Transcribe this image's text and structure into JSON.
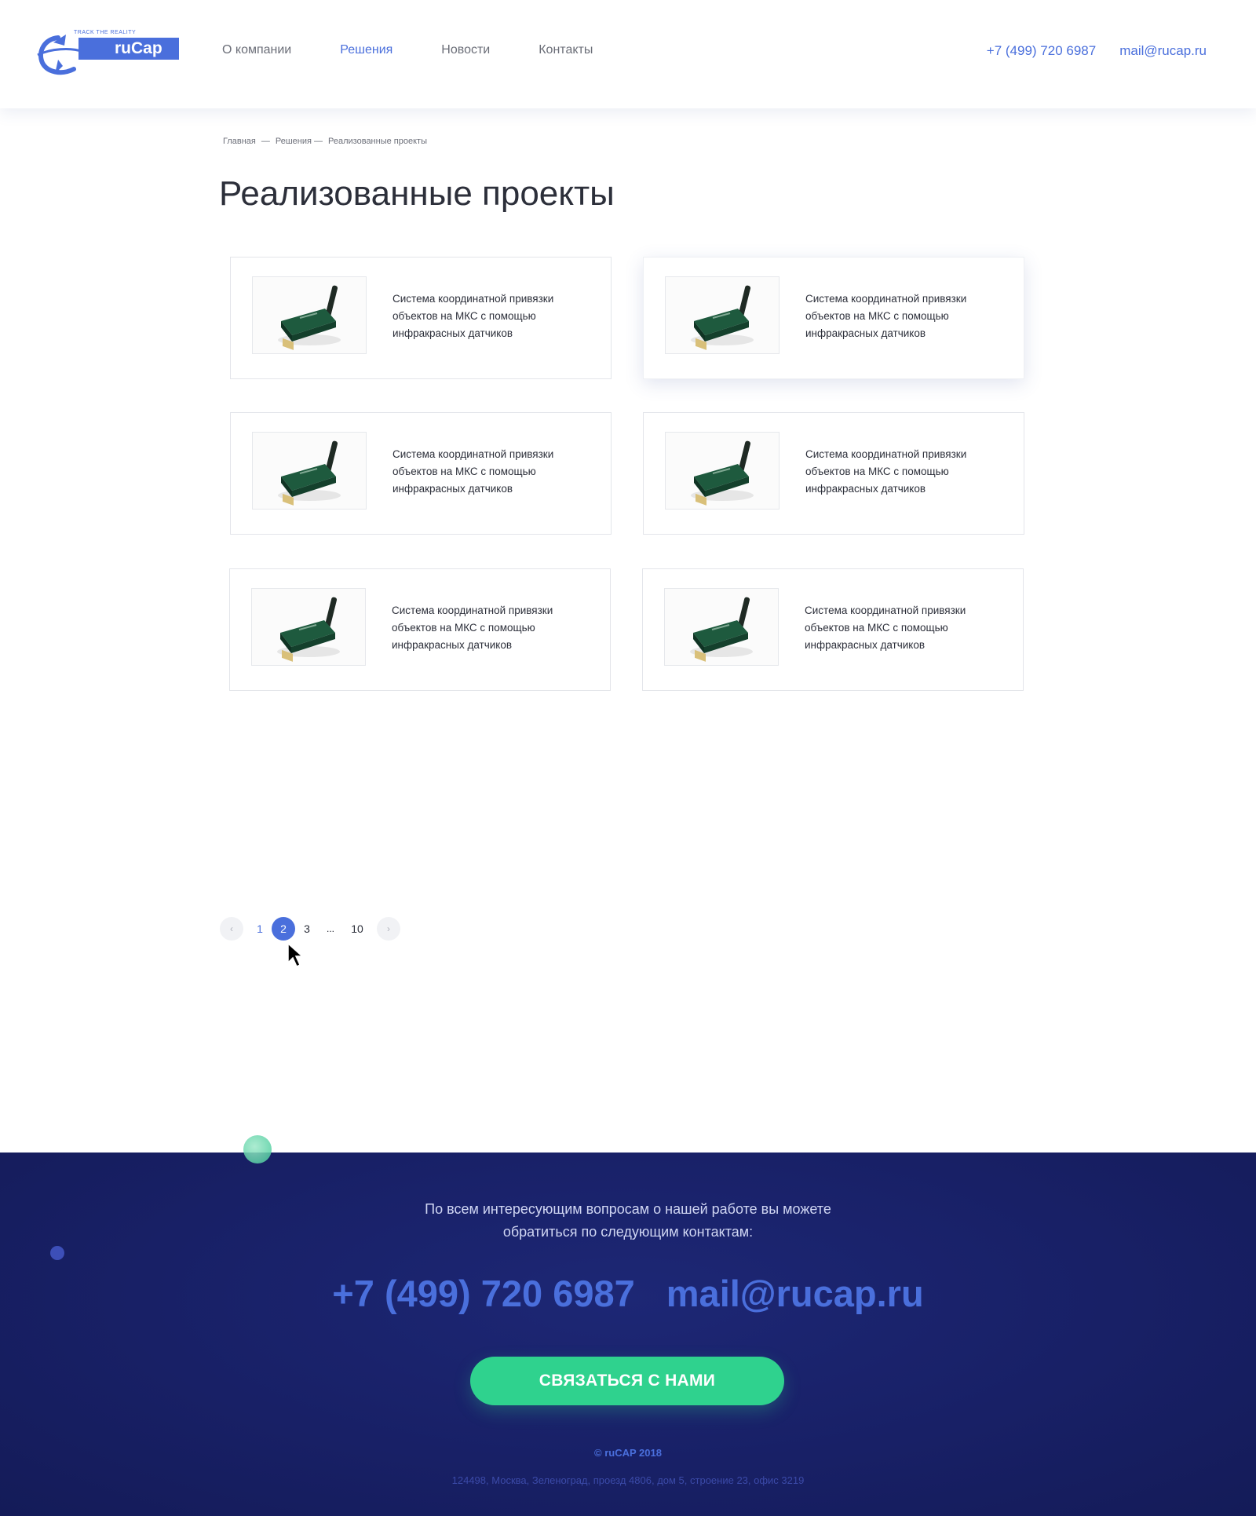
{
  "header": {
    "logo": {
      "tagline": "TRACK THE REALITY",
      "name": "ruCap"
    },
    "nav": [
      {
        "label": "О компании",
        "active": false
      },
      {
        "label": "Решения",
        "active": true
      },
      {
        "label": "Новости",
        "active": false
      },
      {
        "label": "Контакты",
        "active": false
      }
    ],
    "phone": "+7 (499) 720 6987",
    "email": "mail@rucap.ru"
  },
  "breadcrumb": [
    "Главная",
    "—",
    "Решения —",
    "Реализованные проекты"
  ],
  "page_title": "Реализованные проекты",
  "projects": [
    {
      "title": "Система координатной привязки объектов на МКС с помощью инфракрасных датчиков",
      "image": "wireless-modem-icon",
      "highlighted": false
    },
    {
      "title": "Система координатной привязки объектов на МКС с помощью инфракрасных датчиков",
      "image": "wireless-modem-icon",
      "highlighted": true
    },
    {
      "title": "Система координатной привязки объектов на МКС с помощью инфракрасных датчиков",
      "image": "wireless-modem-icon",
      "highlighted": false
    },
    {
      "title": "Система координатной привязки объектов на МКС с помощью инфракрасных датчиков",
      "image": "wireless-modem-icon",
      "highlighted": false
    },
    {
      "title": "Система координатной привязки объектов на МКС с помощью инфракрасных датчиков",
      "image": "wireless-modem-icon",
      "highlighted": false
    },
    {
      "title": "Система координатной привязки объектов на МКС с помощью инфракрасных датчиков",
      "image": "wireless-modem-icon",
      "highlighted": false
    }
  ],
  "pagination": {
    "prev_icon": "chevron-left-icon",
    "next_icon": "chevron-right-icon",
    "pages": [
      "1",
      "2",
      "3",
      "...",
      "10"
    ],
    "current": "2"
  },
  "footer": {
    "lead_line1": "По всем интересующим вопросам о нашей работе вы можете",
    "lead_line2": "обратиться по следующим контактам:",
    "phone": "+7 (499) 720 6987",
    "email": "mail@rucap.ru",
    "cta_label": "СВЯЗАТЬСЯ С НАМИ",
    "copyright": "© ruCAP 2018",
    "address": "124498, Москва, Зеленоград, проезд 4806, дом 5, строение 23, офис 3219"
  },
  "colors": {
    "accent": "#4a6fdc",
    "cta": "#2fd28e",
    "footer_bg": "#182066",
    "text": "#2c2f3a"
  }
}
